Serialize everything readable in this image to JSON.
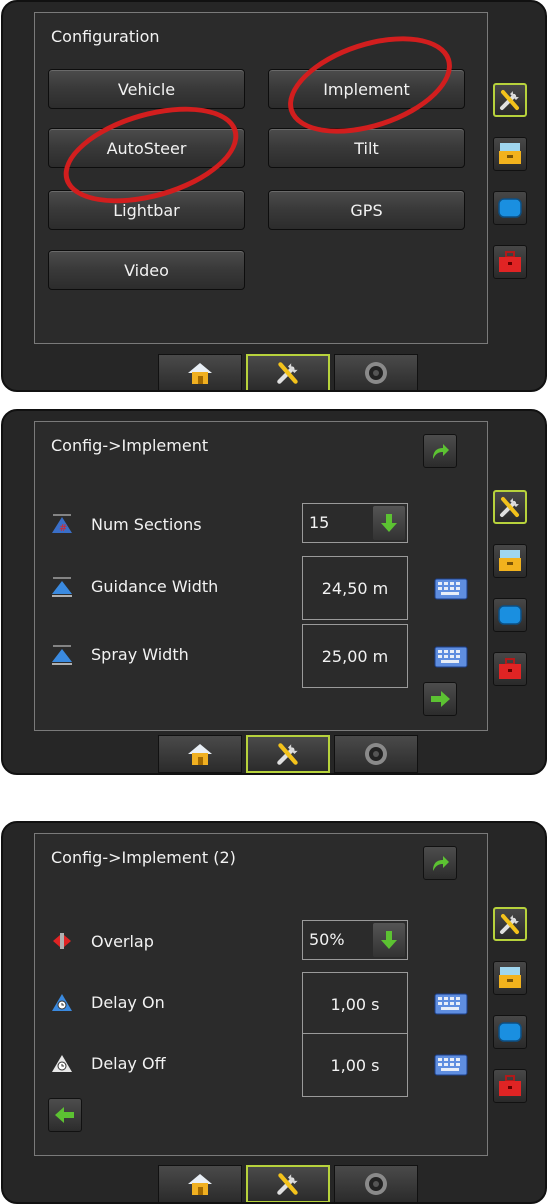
{
  "screen1": {
    "title": "Configuration",
    "buttons": [
      "Vehicle",
      "Implement",
      "AutoSteer",
      "Tilt",
      "Lightbar",
      "GPS",
      "Video"
    ]
  },
  "screen2": {
    "title": "Config->Implement",
    "rows": [
      {
        "label": "Num Sections",
        "value": "15",
        "icon": "sections-icon"
      },
      {
        "label": "Guidance Width",
        "value": "24,50 m",
        "icon": "guidance-width-icon"
      },
      {
        "label": "Spray Width",
        "value": "25,00 m",
        "icon": "spray-width-icon"
      }
    ]
  },
  "screen3": {
    "title": "Config->Implement (2)",
    "rows": [
      {
        "label": "Overlap",
        "value": "50%",
        "icon": "overlap-icon"
      },
      {
        "label": "Delay On",
        "value": "1,00 s",
        "icon": "delay-on-icon"
      },
      {
        "label": "Delay Off",
        "value": "1,00 s",
        "icon": "delay-off-icon"
      }
    ]
  },
  "side_tabs": [
    "tools-icon",
    "console-icon",
    "display-icon",
    "toolbox-icon"
  ],
  "nav": [
    "home-icon",
    "tools-icon",
    "camera-icon"
  ],
  "colors": {
    "accent": "#b7d23c",
    "highlight_ring": "#d21e1e",
    "arrow_green": "#5cc232"
  }
}
